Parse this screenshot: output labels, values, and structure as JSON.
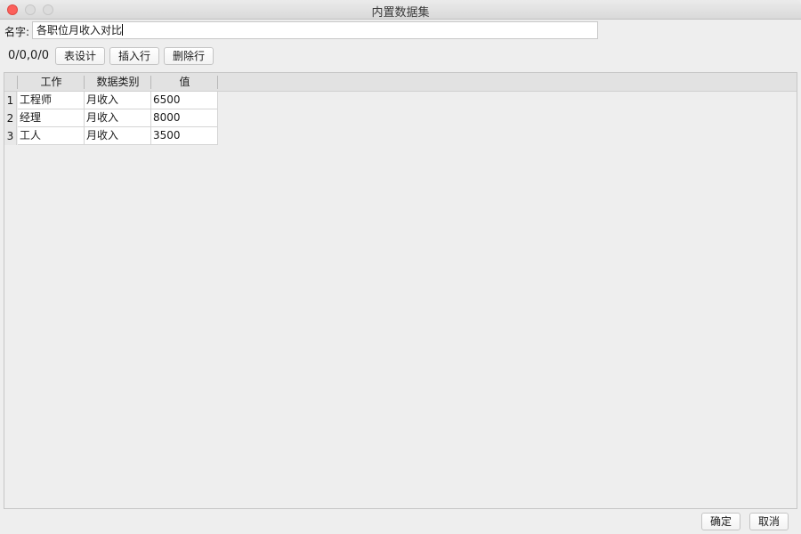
{
  "window": {
    "title": "内置数据集"
  },
  "form": {
    "name_label": "名字:",
    "name_value": "各职位月收入对比"
  },
  "toolbar": {
    "position_text": "0/0,0/0",
    "table_design_label": "表设计",
    "insert_row_label": "插入行",
    "delete_row_label": "删除行"
  },
  "table": {
    "columns": [
      "工作",
      "数据类别",
      "值"
    ],
    "rows": [
      {
        "index": "1",
        "job": "工程师",
        "category": "月收入",
        "value": "6500"
      },
      {
        "index": "2",
        "job": "经理",
        "category": "月收入",
        "value": "8000"
      },
      {
        "index": "3",
        "job": "工人",
        "category": "月收入",
        "value": "3500"
      }
    ]
  },
  "footer": {
    "ok_label": "确定",
    "cancel_label": "取消"
  },
  "colors": {
    "close_button": "#fc605b",
    "header_bg": "#e2e2e2",
    "cell_bg": "#ffffff"
  }
}
